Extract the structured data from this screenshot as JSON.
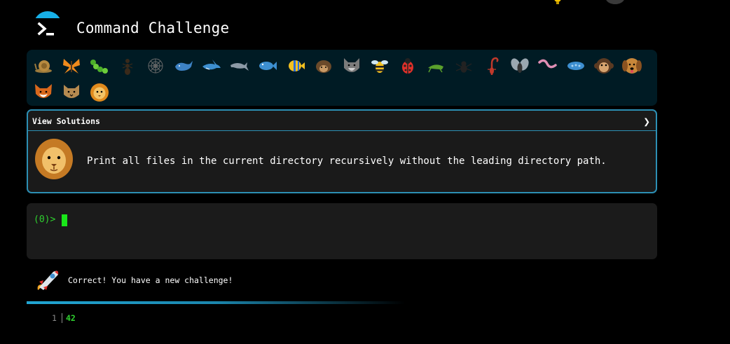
{
  "header": {
    "title": "Command Challenge",
    "logo_icon": "terminal-prompt-icon"
  },
  "animal_strip": {
    "row1": [
      "snail-icon",
      "butterfly-icon",
      "caterpillar-icon",
      "ant-icon",
      "spider-web-icon",
      "whale-icon",
      "shark-icon",
      "dolphin-icon",
      "fish-icon",
      "tropical-fish-icon",
      "hedgehog-icon",
      "wolf-icon",
      "bee-icon",
      "ladybug-icon",
      "cricket-icon",
      "spider-icon",
      "scorpion-icon",
      "fly-icon",
      "worm-icon",
      "microbe-icon",
      "monkey-icon",
      "dog-icon"
    ],
    "row2": [
      "fox-icon",
      "cat-icon",
      "lion-icon"
    ]
  },
  "challenge": {
    "view_solutions_label": "View Solutions",
    "chevron": "❯",
    "text": "Print all files in the current directory recursively without the leading directory path.",
    "avatar_icon": "lion-icon"
  },
  "terminal": {
    "prompt": "(0)>"
  },
  "message": {
    "text": "Correct! You have a new challenge!",
    "icon": "rocket-icon"
  },
  "output": {
    "line_number": "1",
    "value": "42"
  },
  "colors": {
    "accent": "#2c8fb4",
    "prompt_green": "#2fd12f",
    "strip_bg": "#001b24"
  }
}
